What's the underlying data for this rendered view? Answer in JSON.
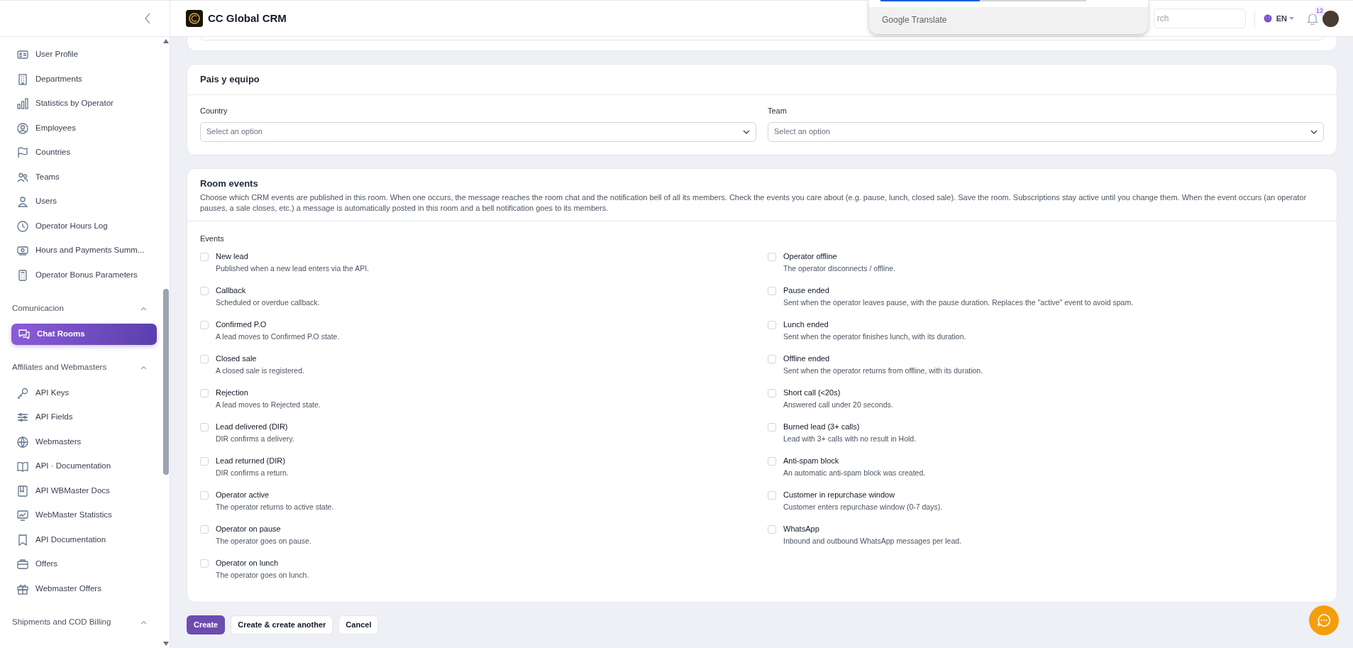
{
  "header": {
    "app_name": "CC Global CRM",
    "search": {
      "placeholder": "rch"
    },
    "language": "EN",
    "notifications_count": "12"
  },
  "translate_popup": {
    "label": "Google Translate"
  },
  "sidebar": {
    "items": [
      {
        "label": "User Profile",
        "selected": false
      },
      {
        "label": "Departments",
        "selected": false
      },
      {
        "label": "Statistics by Operator",
        "selected": false
      },
      {
        "label": "Employees",
        "selected": false
      },
      {
        "label": "Countries",
        "selected": false
      },
      {
        "label": "Teams",
        "selected": false
      },
      {
        "label": "Users",
        "selected": false
      },
      {
        "label": "Operator Hours Log",
        "selected": false
      },
      {
        "label": "Hours and Payments Summ...",
        "selected": false
      },
      {
        "label": "Operator Bonus Parameters",
        "selected": false
      }
    ],
    "groups": [
      {
        "title": "Comunicacion",
        "expanded": true,
        "items": [
          {
            "label": "Chat Rooms",
            "selected": true
          }
        ]
      },
      {
        "title": "Affiliates and Webmasters",
        "expanded": true,
        "items": [
          {
            "label": "API Keys",
            "selected": false
          },
          {
            "label": "API Fields",
            "selected": false
          },
          {
            "label": "Webmasters",
            "selected": false
          },
          {
            "label": "API · Documentation",
            "selected": false
          },
          {
            "label": "API WBMaster Docs",
            "selected": false
          },
          {
            "label": "WebMaster Statistics",
            "selected": false
          },
          {
            "label": "API Documentation",
            "selected": false
          },
          {
            "label": "Offers",
            "selected": false
          },
          {
            "label": "Webmaster Offers",
            "selected": false
          }
        ]
      },
      {
        "title": "Shipments and COD Billing",
        "expanded": true
      }
    ]
  },
  "country_team_section": {
    "title": "Pais y equipo",
    "fields": [
      {
        "label": "Country",
        "placeholder": "Select an option"
      },
      {
        "label": "Team",
        "placeholder": "Select an option"
      }
    ]
  },
  "room_events_section": {
    "title": "Room events",
    "description": "Choose which CRM events are published in this room. When one occurs, the message reaches the room chat and the notification bell of all its members. Check the events you care about (e.g. pause, lunch, closed sale). Save the room. Subscriptions stay active until you change them. When the event occurs (an operator pauses, a sale closes, etc.) a message is automatically posted in this room and a bell notification goes to its members.",
    "events_label": "Events",
    "columns": [
      [
        {
          "label": "New lead",
          "hint": "Published when a new lead enters via the API.",
          "checked": false
        },
        {
          "label": "Callback",
          "hint": "Scheduled or overdue callback.",
          "checked": false
        },
        {
          "label": "Confirmed P.O",
          "hint": "A lead moves to Confirmed P.O state.",
          "checked": false
        },
        {
          "label": "Closed sale",
          "hint": "A closed sale is registered.",
          "checked": false
        },
        {
          "label": "Rejection",
          "hint": "A lead moves to Rejected state.",
          "checked": false
        },
        {
          "label": "Lead delivered (DIR)",
          "hint": "DIR confirms a delivery.",
          "checked": false
        },
        {
          "label": "Lead returned (DIR)",
          "hint": "DIR confirms a return.",
          "checked": false
        },
        {
          "label": "Operator active",
          "hint": "The operator returns to active state.",
          "checked": false
        },
        {
          "label": "Operator on pause",
          "hint": "The operator goes on pause.",
          "checked": false
        },
        {
          "label": "Operator on lunch",
          "hint": "The operator goes on lunch.",
          "checked": false
        }
      ],
      [
        {
          "label": "Operator offline",
          "hint": "The operator disconnects / offline.",
          "checked": false
        },
        {
          "label": "Pause ended",
          "hint": "Sent when the operator leaves pause, with the pause duration. Replaces the \"active\" event to avoid spam.",
          "checked": false
        },
        {
          "label": "Lunch ended",
          "hint": "Sent when the operator finishes lunch, with its duration.",
          "checked": false
        },
        {
          "label": "Offline ended",
          "hint": "Sent when the operator returns from offline, with its duration.",
          "checked": false
        },
        {
          "label": "Short call (<20s)",
          "hint": "Answered call under 20 seconds.",
          "checked": false
        },
        {
          "label": "Burned lead (3+ calls)",
          "hint": "Lead with 3+ calls with no result in Hold.",
          "checked": false
        },
        {
          "label": "Anti-spam block",
          "hint": "An automatic anti-spam block was created.",
          "checked": false
        },
        {
          "label": "Customer in repurchase window",
          "hint": "Customer enters repurchase window (0-7 days).",
          "checked": false
        },
        {
          "label": "WhatsApp",
          "hint": "Inbound and outbound WhatsApp messages per lead.",
          "checked": false
        }
      ]
    ]
  },
  "actions": [
    {
      "label": "Create",
      "kind": "primary"
    },
    {
      "label": "Create & create another",
      "kind": "secondary"
    },
    {
      "label": "Cancel",
      "kind": "secondary"
    }
  ]
}
